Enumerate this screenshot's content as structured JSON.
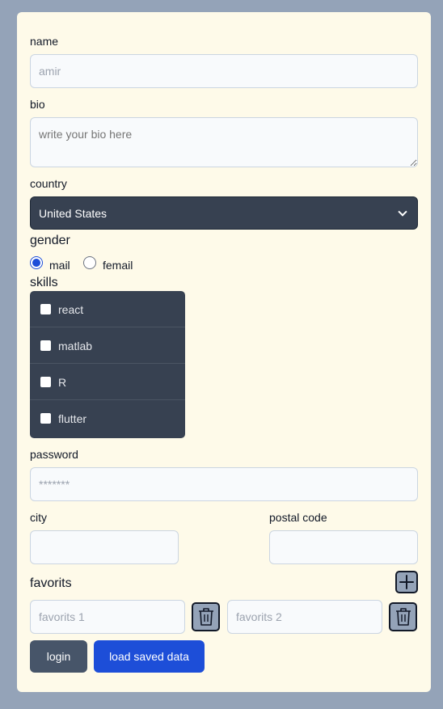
{
  "form": {
    "name_label": "name",
    "name_value": "amir",
    "bio_label": "bio",
    "bio_placeholder": "write your bio here",
    "country_label": "country",
    "country_selected": "United States",
    "gender_label": "gender",
    "gender_options": [
      {
        "label": "mail",
        "selected": true
      },
      {
        "label": "femail",
        "selected": false
      }
    ],
    "skills_label": "skills",
    "skills": [
      {
        "label": "react",
        "checked": false
      },
      {
        "label": "matlab",
        "checked": false
      },
      {
        "label": "R",
        "checked": false
      },
      {
        "label": "flutter",
        "checked": false
      }
    ],
    "password_label": "password",
    "password_value": "*******",
    "city_label": "city",
    "city_value": "",
    "postal_label": "postal code",
    "postal_value": "",
    "favorites_label": "favorits",
    "favorites": [
      {
        "placeholder": "favorits 1"
      },
      {
        "placeholder": "favorits 2"
      }
    ],
    "login_label": "login",
    "load_label": "load saved data"
  },
  "colors": {
    "page_bg": "#94a3b8",
    "card_bg": "#fefae9",
    "dark_control": "#374151",
    "primary_button": "#1d4ed8",
    "login_button": "#475569"
  },
  "icons": {
    "add": "plus-icon",
    "delete": "trash-icon",
    "dropdown": "chevron-down-icon"
  }
}
